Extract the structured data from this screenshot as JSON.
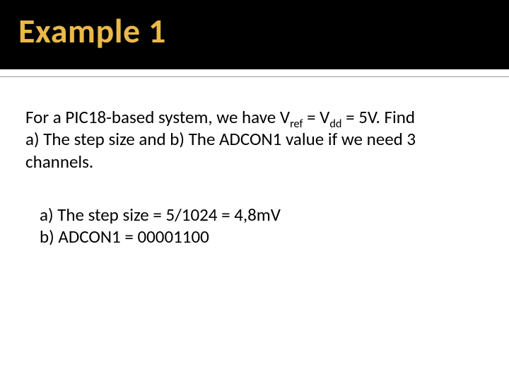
{
  "title": "Example 1",
  "problem": {
    "line1_pre": "For a PIC18-based system, we have V",
    "sub1": "ref",
    "mid1": " = V",
    "sub2": "dd",
    "post1": " = 5V. Find",
    "line2": "a) The step size and b) The ADCON1 value if we need  3",
    "line3": "channels."
  },
  "answers": {
    "a": "a) The step size = 5/1024 = 4,8mV",
    "b": "b) ADCON1 = 00001100"
  }
}
